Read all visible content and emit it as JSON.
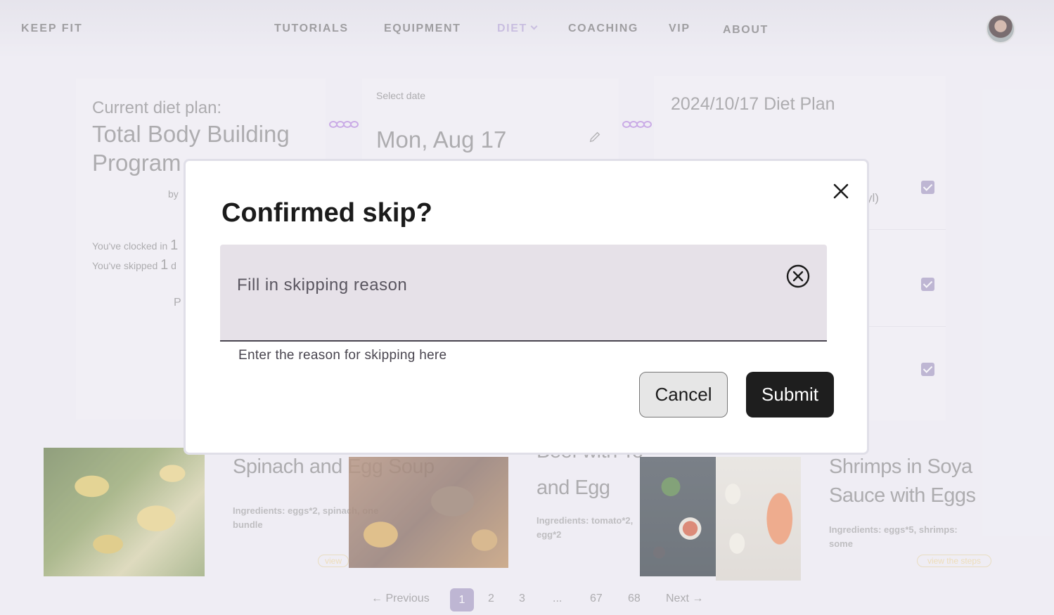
{
  "nav": {
    "brand": "KEEP FIT",
    "items": [
      {
        "label": "TUTORIALS"
      },
      {
        "label": "EQUIPMENT"
      },
      {
        "label": "DIET"
      },
      {
        "label": "COACHING"
      },
      {
        "label": "VIP"
      },
      {
        "label": "ABOUT"
      }
    ],
    "active_color": "#b7a8d8"
  },
  "plan_card": {
    "heading": "Current diet plan:",
    "name_line1": "Total Body Building",
    "name_line2": "Program",
    "by_prefix": "by",
    "clocked_prefix": "You've clocked in",
    "clocked_value": "1",
    "skipped_prefix": "You've skipped",
    "skipped_value": "1",
    "skipped_suffix": "d",
    "partial_letter": "P"
  },
  "date_card": {
    "label": "Select date",
    "value": "Mon, Aug 17"
  },
  "diet_plan_card": {
    "title": "2024/10/17 Diet Plan",
    "partial_text": "yl)"
  },
  "recipes": [
    {
      "title": "Spinach and Egg Soup",
      "ingredients_line1": "Ingredients: eggs*2, spinach, one",
      "ingredients_line2": "bundle",
      "steps_label": "view"
    },
    {
      "title_line1": "Beef with To",
      "title_line2": "and Egg",
      "ingredients_line1": "Ingredients: tomato*2,",
      "ingredients_line2": "egg*2"
    },
    {
      "title_line1": "Shrimps in Soya",
      "title_line2": "Sauce with Eggs",
      "ingredients_line1": "Ingredients: eggs*5, shrimps:",
      "ingredients_line2": "some",
      "steps_label": "view the steps"
    }
  ],
  "pagination": {
    "previous": "Previous",
    "pages": [
      "1",
      "2",
      "3",
      "...",
      "67",
      "68"
    ],
    "current": "1",
    "next": "Next"
  },
  "modal": {
    "title": "Confirmed skip?",
    "input_placeholder": "Fill in skipping reason",
    "input_value": "",
    "helper_text": "Enter the reason for skipping here",
    "cancel_label": "Cancel",
    "submit_label": "Submit",
    "close_icon": "close-icon",
    "clear_icon": "clear-circle-icon"
  }
}
